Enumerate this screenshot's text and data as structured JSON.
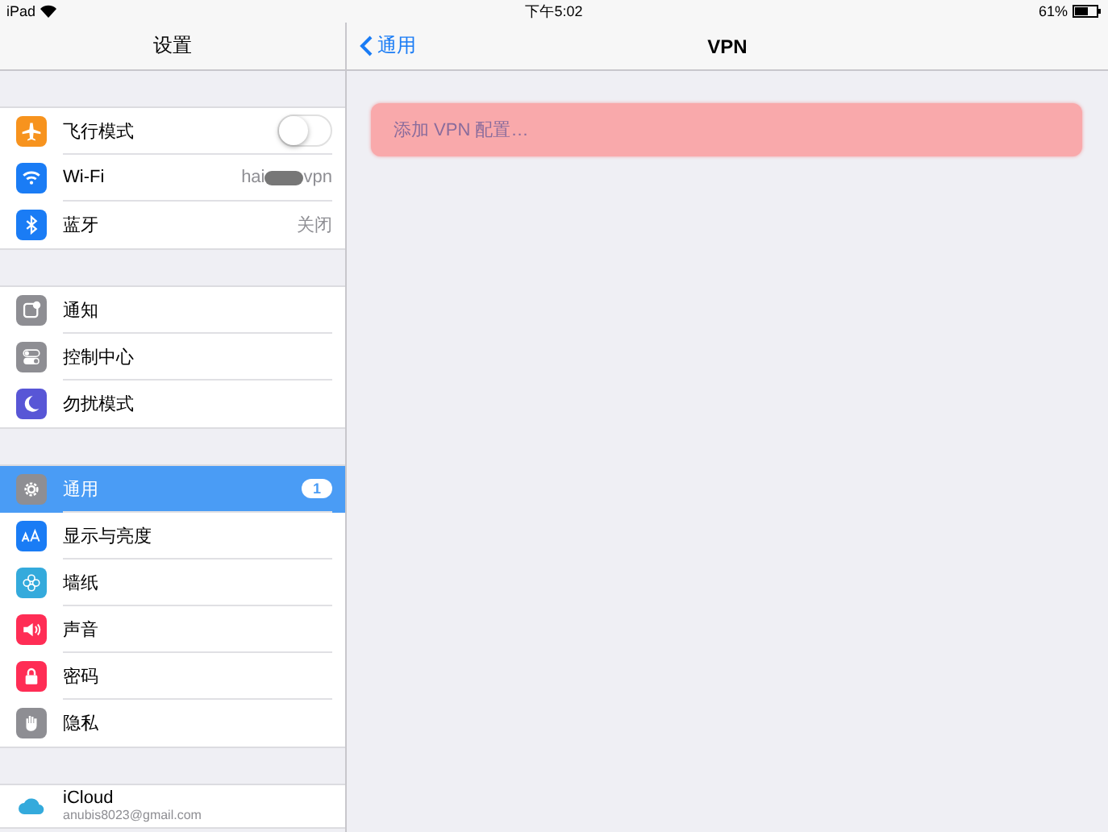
{
  "status_bar": {
    "device": "iPad",
    "time": "下午5:02",
    "battery": "61%"
  },
  "sidebar": {
    "title": "设置",
    "groups": [
      {
        "items": [
          {
            "label": "飞行模式",
            "color": "#f7931e",
            "kind": "toggle",
            "on": false,
            "selected": false
          },
          {
            "label": "Wi-Fi",
            "color": "#1a7cf5",
            "kind": "redacted",
            "value_parts": [
              "hai",
              "vpn"
            ],
            "selected": false
          },
          {
            "label": "蓝牙",
            "color": "#1a7cf5",
            "kind": "value",
            "value": "关闭",
            "selected": false
          }
        ]
      },
      {
        "items": [
          {
            "label": "通知",
            "color": "#8e8e93",
            "kind": "plain",
            "selected": false
          },
          {
            "label": "控制中心",
            "color": "#8e8e93",
            "kind": "plain",
            "selected": false
          },
          {
            "label": "勿扰模式",
            "color": "#5856d6",
            "kind": "plain",
            "selected": false
          }
        ]
      },
      {
        "items": [
          {
            "label": "通用",
            "color": "#8e8e93",
            "kind": "badge",
            "badge": "1",
            "selected": true
          },
          {
            "label": "显示与亮度",
            "color": "#1a7cf5",
            "kind": "plain",
            "selected": false
          },
          {
            "label": "墙纸",
            "color": "#34aadc",
            "kind": "plain",
            "selected": false
          },
          {
            "label": "声音",
            "color": "#ff2d55",
            "kind": "plain",
            "selected": false
          },
          {
            "label": "密码",
            "color": "#ff2d55",
            "kind": "plain",
            "selected": false
          },
          {
            "label": "隐私",
            "color": "#8e8e93",
            "kind": "plain",
            "selected": false
          }
        ]
      },
      {
        "items": [
          {
            "label": "iCloud",
            "color": "#ffffff",
            "kind": "account",
            "subtitle": "anubis8023@gmail.com",
            "selected": false
          }
        ]
      }
    ]
  },
  "detail": {
    "back": "通用",
    "title": "VPN",
    "add_button": "添加 VPN 配置…"
  }
}
